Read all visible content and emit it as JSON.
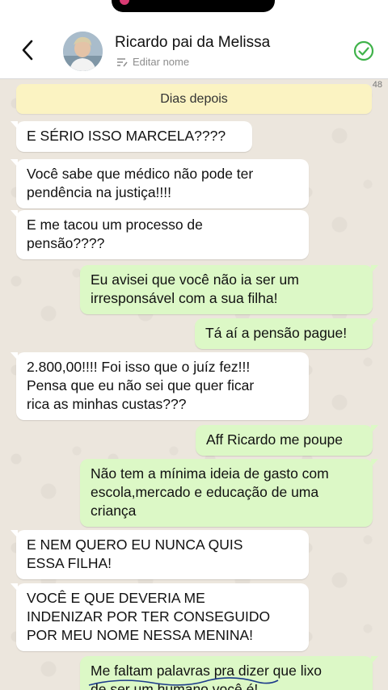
{
  "header": {
    "contact_name": "Ricardo pai da Melissa",
    "edit_label": "Editar nome"
  },
  "chat": {
    "counter": "48",
    "system_message": "Dias depois",
    "messages": [
      {
        "dir": "in",
        "text": "E SÉRIO ISSO MARCELA????"
      },
      {
        "dir": "in",
        "text": "Você sabe que médico não pode ter\npendência na justiça!!!!"
      },
      {
        "dir": "in",
        "text": "E me tacou um processo de\npensão????"
      },
      {
        "dir": "out",
        "text": "Eu avisei que você não ia ser um\nirresponsável com a sua filha!"
      },
      {
        "dir": "out",
        "text": "Tá aí a pensão pague!"
      },
      {
        "dir": "in",
        "text": "2.800,00!!!! Foi isso que o juíz fez!!!\nPensa que eu não sei que quer ficar\nrica as minhas custas???"
      },
      {
        "dir": "out",
        "text": "Aff Ricardo me poupe"
      },
      {
        "dir": "out",
        "text": "Não tem a mínima ideia de gasto com\nescola,mercado e educação de uma\ncriança"
      },
      {
        "dir": "in",
        "text": "E NEM QUERO EU NUNCA QUIS\nESSA FILHA!"
      },
      {
        "dir": "in",
        "text": "VOCÊ E QUE DEVERIA ME\nINDENIZAR POR TER CONSEGUIDO\nPOR MEU NOME NESSA MENINA!"
      },
      {
        "dir": "out",
        "text": "Me faltam palavras pra dizer que lixo\nde ser um humano você é!"
      }
    ]
  }
}
